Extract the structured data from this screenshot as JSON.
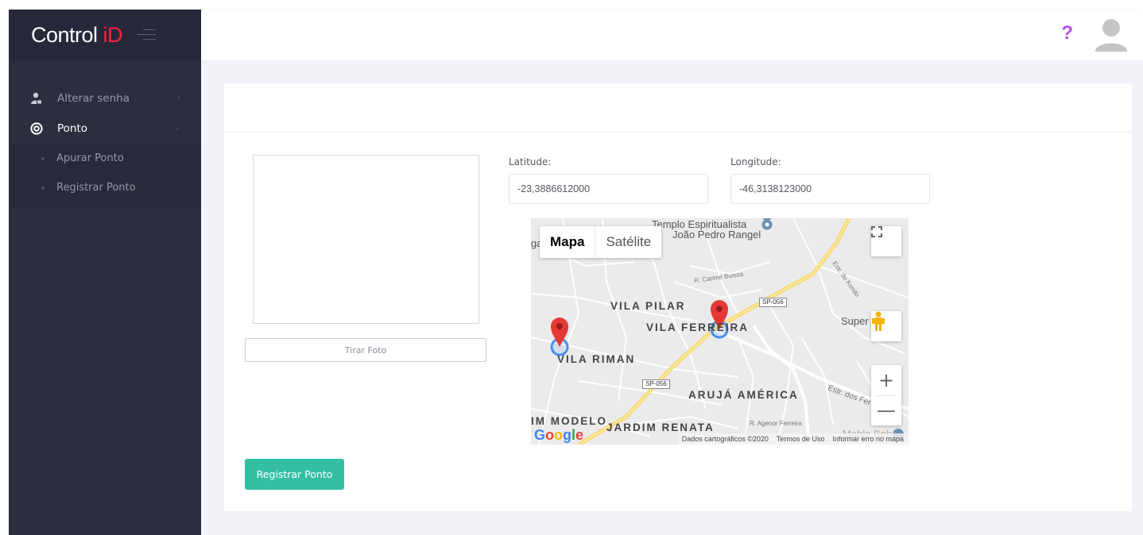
{
  "brand": {
    "name": "Control",
    "accent": "iD"
  },
  "sidebar": {
    "items": [
      {
        "label": "Alterar senha",
        "icon": "user-lock-icon"
      },
      {
        "label": "Ponto",
        "icon": "target-icon",
        "expanded": true,
        "children": [
          {
            "label": "Apurar Ponto"
          },
          {
            "label": "Registrar Ponto"
          }
        ]
      }
    ]
  },
  "header": {
    "help": "?",
    "avatar_icon": "user-avatar-icon"
  },
  "form": {
    "take_photo_label": "Tirar Foto",
    "latitude_label": "Latitude:",
    "latitude_value": "-23,3886612000",
    "longitude_label": "Longitude:",
    "longitude_value": "-46,3138123000",
    "submit_label": "Registrar Ponto"
  },
  "map": {
    "type_map": "Mapa",
    "type_satellite": "Satélite",
    "labels": {
      "poi_name_1": "Templo Espiritualista",
      "poi_name_2": "João Pedro Rangel",
      "vila_pilar": "VILA PILAR",
      "vila_ferreira": "VILA FERREIRA",
      "vila_riman": "VILA RIMAN",
      "aruja_america": "ARUJÁ AMÉRICA",
      "jardim_modelo": "IM MODELO",
      "jardim_renata": "JARDIM RENATA",
      "r_carime": "R. Carime Buissa",
      "estr_kondo": "Estr. do Kondo",
      "estr_ferreiros": "Estr. dos Fer",
      "r_agenor": "R. Agenor Ferreira",
      "super": "Super",
      "mahle": "Mahle Behr",
      "road_shield_1": "SP-056",
      "road_shield_2": "SP-056",
      "edge_ga": "ga"
    },
    "google": "Google",
    "footer": {
      "data": "Dados cartográficos ©2020",
      "terms": "Termos de Uso",
      "report": "Informar erro no mapa"
    },
    "zoom_in": "+",
    "zoom_out": "—"
  },
  "colors": {
    "accent": "#ff1f3f",
    "help": "#b252e0",
    "submit": "#34bfa3",
    "sidebar": "#2c2e3e"
  }
}
